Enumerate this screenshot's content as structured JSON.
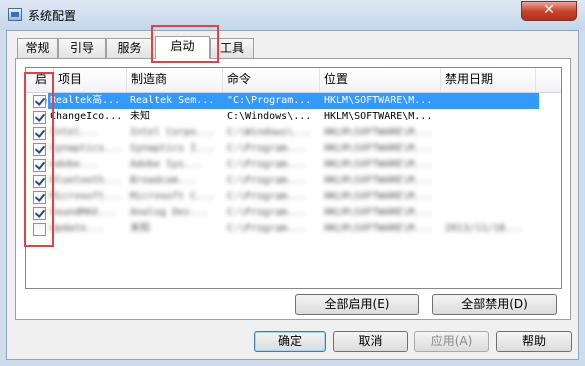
{
  "window": {
    "title": "系统配置",
    "close_glyph": "✕"
  },
  "tabs": [
    {
      "label": "常规"
    },
    {
      "label": "引导"
    },
    {
      "label": "服务"
    },
    {
      "label": "启动"
    },
    {
      "label": "工具"
    }
  ],
  "table": {
    "columns": [
      "启动",
      "项目",
      "制造商",
      "命令",
      "位置",
      "禁用日期"
    ],
    "rows": [
      {
        "checked": true,
        "item": "Realtek高...",
        "maker": "Realtek Sem...",
        "command": "\"C:\\Program...",
        "location": "HKLM\\SOFTWARE\\M...",
        "date": ""
      },
      {
        "checked": true,
        "item": "ChangeIco...",
        "maker": "未知",
        "command": "C:\\Windows\\...",
        "location": "HKLM\\SOFTWARE\\M...",
        "date": ""
      },
      {
        "checked": true,
        "item": "Intel...",
        "maker": "Intel Corpo...",
        "command": "C:\\Windows\\...",
        "location": "HKLM\\SOFTWARE\\M...",
        "date": ""
      },
      {
        "checked": true,
        "item": "Synaptics...",
        "maker": "Synaptics I...",
        "command": "C:\\Program...",
        "location": "HKLM\\SOFTWARE\\M...",
        "date": ""
      },
      {
        "checked": true,
        "item": "Adobe...",
        "maker": "Adobe Sys...",
        "command": "C:\\Program...",
        "location": "HKLM\\SOFTWARE\\M...",
        "date": ""
      },
      {
        "checked": true,
        "item": "Bluetooth...",
        "maker": "Broadcom...",
        "command": "C:\\Program...",
        "location": "HKLM\\SOFTWARE\\M...",
        "date": ""
      },
      {
        "checked": true,
        "item": "Microsoft...",
        "maker": "Microsoft C...",
        "command": "C:\\Program...",
        "location": "HKLM\\SOFTWARE\\M...",
        "date": ""
      },
      {
        "checked": true,
        "item": "SoundMAX...",
        "maker": "Analog Dev...",
        "command": "C:\\Program...",
        "location": "HKLM\\SOFTWARE\\M...",
        "date": ""
      },
      {
        "checked": false,
        "item": "Update...",
        "maker": "未知",
        "command": "C:\\Program...",
        "location": "HKLM\\SOFTWARE\\M...",
        "date": "2013/11/18..."
      }
    ]
  },
  "buttons": {
    "enable_all": "全部启用(E)",
    "disable_all": "全部禁用(D)",
    "ok": "确定",
    "cancel": "取消",
    "apply": "应用(A)",
    "help": "帮助"
  },
  "colors": {
    "selection": "#3399ff",
    "annotation_red": "#dd4444"
  }
}
